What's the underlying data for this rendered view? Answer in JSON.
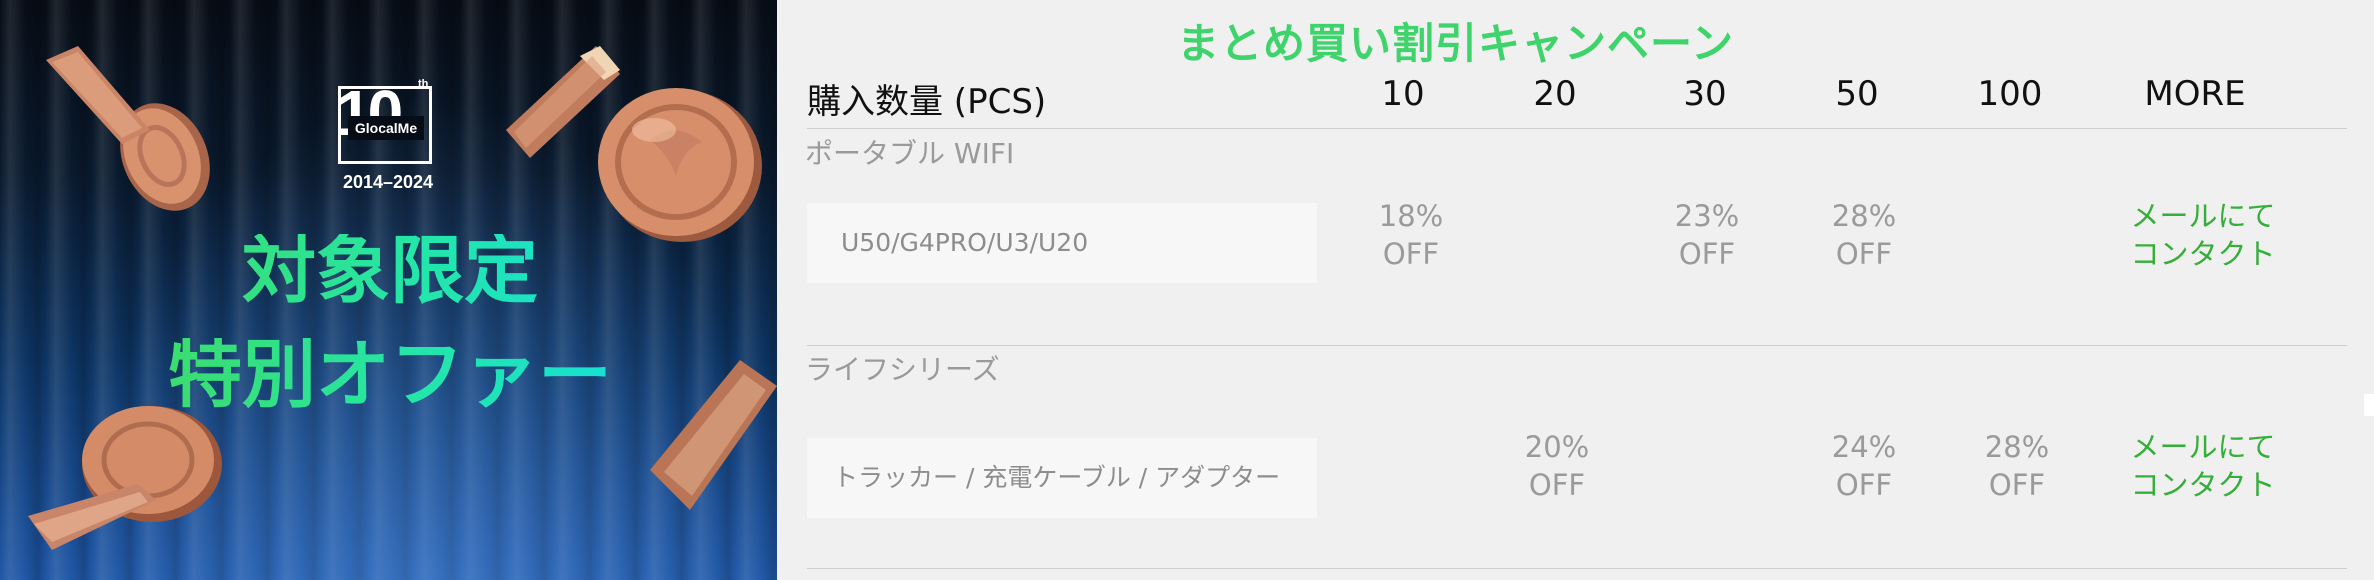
{
  "banner": {
    "logo": {
      "number": "10",
      "suffix": "th",
      "brand": "GlocalMe"
    },
    "years": "2014–2024",
    "headline_line1": "対象限定",
    "headline_line2": "特別オファー"
  },
  "campaign": {
    "title": "まとめ買い割引キャンペーン",
    "header": {
      "quantity_label": "購入数量 (PCS)",
      "columns": [
        "10",
        "20",
        "30",
        "50",
        "100",
        "MORE"
      ]
    },
    "sections": [
      {
        "name": "ポータブル WIFI",
        "product": "U50/G4PRO/U3/U20",
        "discounts": [
          {
            "percent": "18%",
            "off": "OFF"
          },
          {
            "percent": "",
            "off": ""
          },
          {
            "percent": "23%",
            "off": "OFF"
          },
          {
            "percent": "28%",
            "off": "OFF"
          },
          {
            "percent": "",
            "off": ""
          }
        ],
        "contact_line1": "メールにて",
        "contact_line2": "コンタクト"
      },
      {
        "name": "ライフシリーズ",
        "product": "トラッカー / 充電ケーブル / アダプター",
        "discounts": [
          {
            "percent": "",
            "off": ""
          },
          {
            "percent": "20%",
            "off": "OFF"
          },
          {
            "percent": "",
            "off": ""
          },
          {
            "percent": "24%",
            "off": "OFF"
          },
          {
            "percent": "28%",
            "off": "OFF"
          }
        ],
        "contact_line1": "メールにて",
        "contact_line2": "コンタクト"
      }
    ]
  },
  "colors": {
    "title_green": "#3fd36b",
    "contact_green": "#36ae3a",
    "muted_text": "#9a9a9a",
    "coin_copper": "#d9926e"
  },
  "icons": [
    "coin-icon",
    "ribbon-icon"
  ]
}
